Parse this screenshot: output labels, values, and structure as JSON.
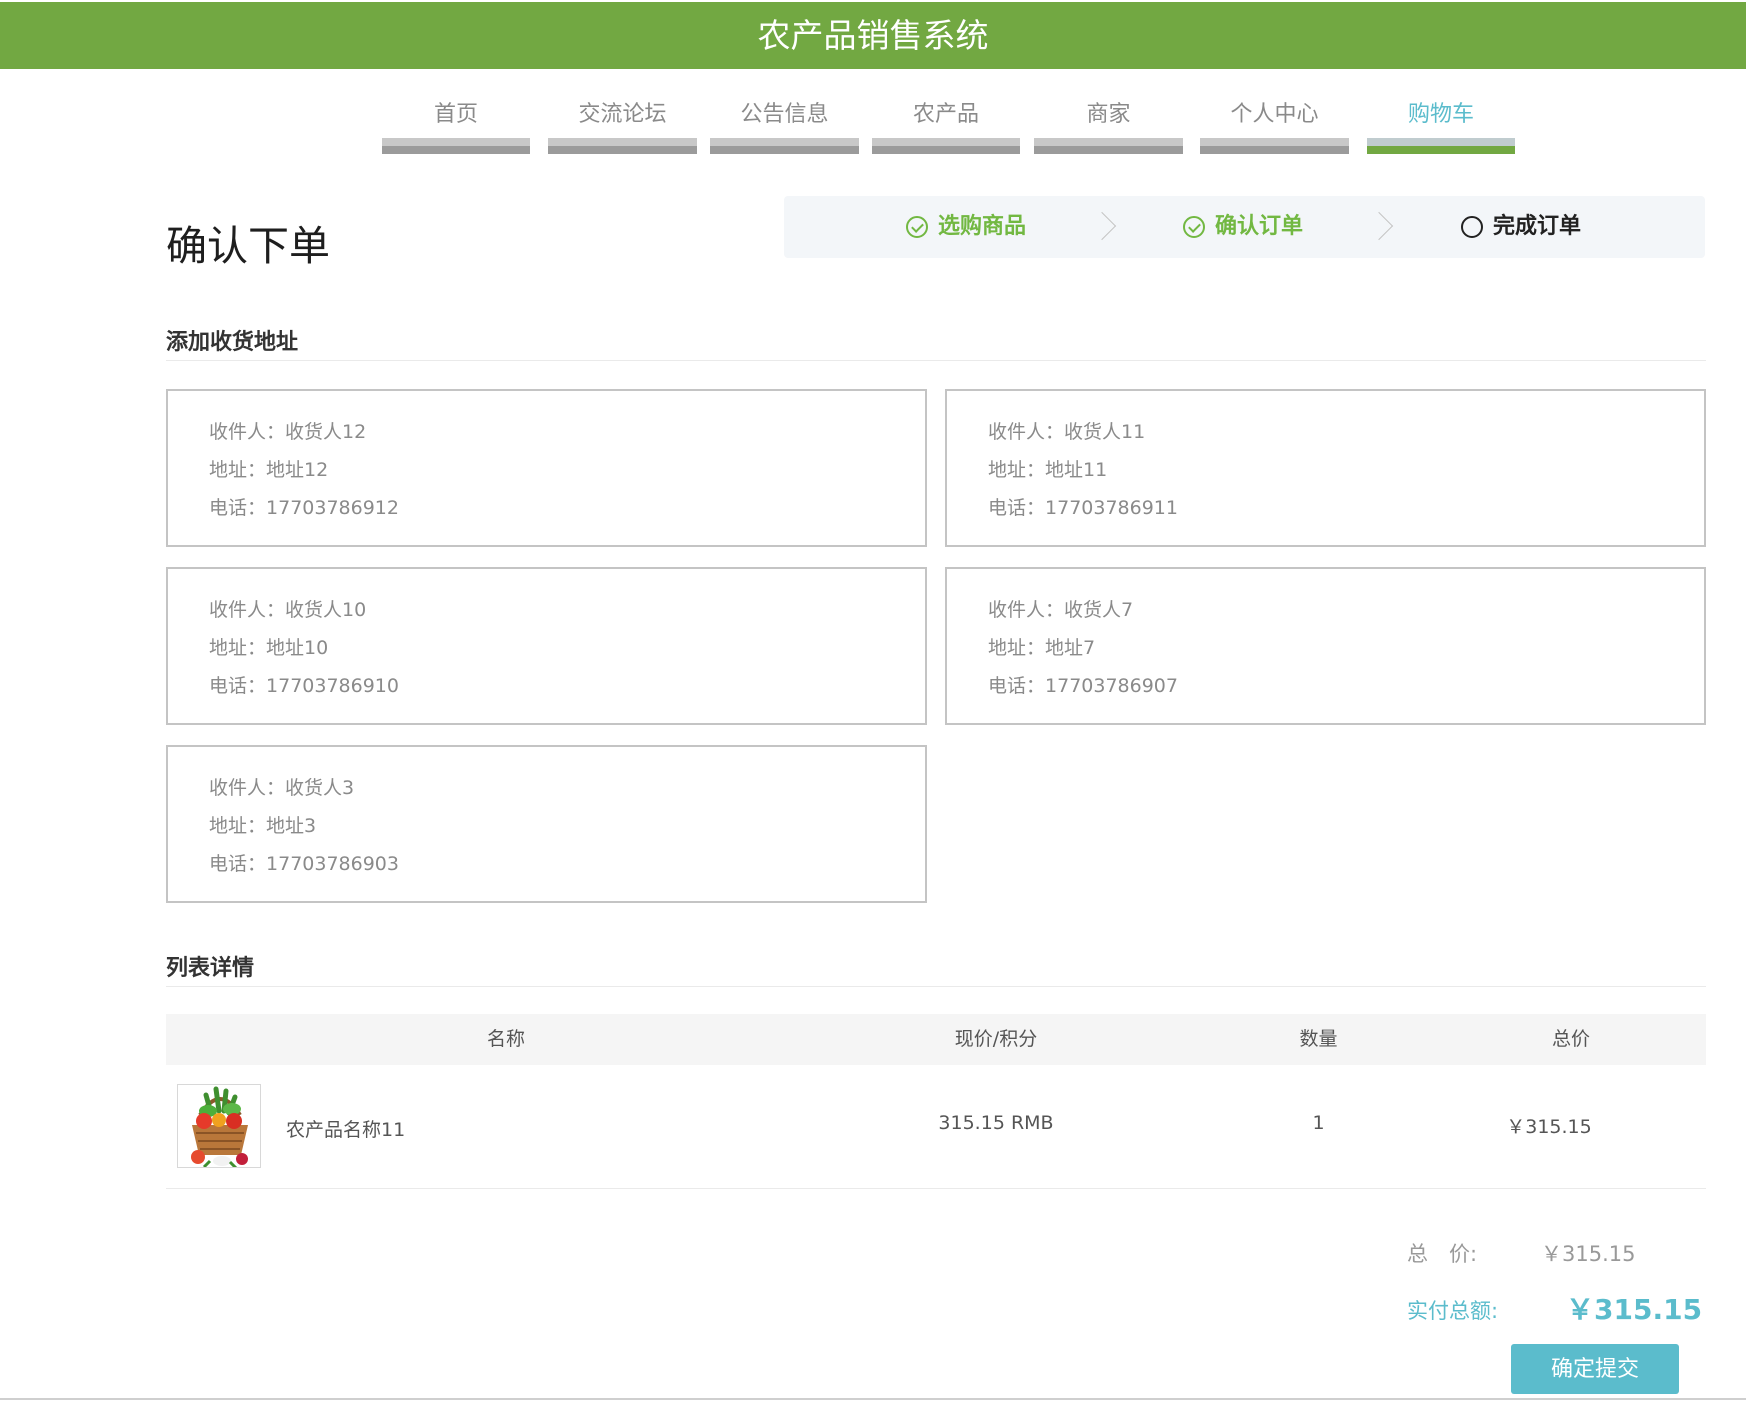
{
  "app": {
    "title": "农产品销售系统"
  },
  "nav": {
    "items": [
      {
        "label": "首页"
      },
      {
        "label": "交流论坛"
      },
      {
        "label": "公告信息"
      },
      {
        "label": "农产品"
      },
      {
        "label": "商家"
      },
      {
        "label": "个人中心"
      },
      {
        "label": "购物车"
      }
    ],
    "active": "购物车"
  },
  "page": {
    "title": "确认下单"
  },
  "steps": [
    {
      "label": "选购商品",
      "status": "done",
      "icon": "check-circle-icon"
    },
    {
      "label": "确认订单",
      "status": "done",
      "icon": "check-circle-icon"
    },
    {
      "label": "完成订单",
      "status": "current",
      "icon": "circle-icon"
    }
  ],
  "address_section": {
    "title": "添加收货地址",
    "prefix": {
      "name": "收件人：",
      "address": "地址：",
      "phone": "电话："
    },
    "addresses": [
      {
        "name": "收货人12",
        "address": "地址12",
        "phone": "17703786912"
      },
      {
        "name": "收货人11",
        "address": "地址11",
        "phone": "17703786911"
      },
      {
        "name": "收货人10",
        "address": "地址10",
        "phone": "17703786910"
      },
      {
        "name": "收货人7",
        "address": "地址7",
        "phone": "17703786907"
      },
      {
        "name": "收货人3",
        "address": "地址3",
        "phone": "17703786903"
      }
    ]
  },
  "list_section": {
    "title": "列表详情",
    "headers": {
      "name": "名称",
      "price": "现价/积分",
      "quantity": "数量",
      "total": "总价"
    },
    "items": [
      {
        "name": "农产品名称11",
        "price": "315.15 RMB",
        "quantity": "1",
        "total": "￥315.15"
      }
    ]
  },
  "summary": {
    "total_label": "总　价:",
    "total_value": "￥315.15",
    "pay_label": "实付总额:",
    "pay_value": "￥315.15",
    "submit_label": "确定提交"
  },
  "colors": {
    "brand_green": "#72a842",
    "accent_teal": "#5bbccc",
    "step_green": "#72b842"
  }
}
